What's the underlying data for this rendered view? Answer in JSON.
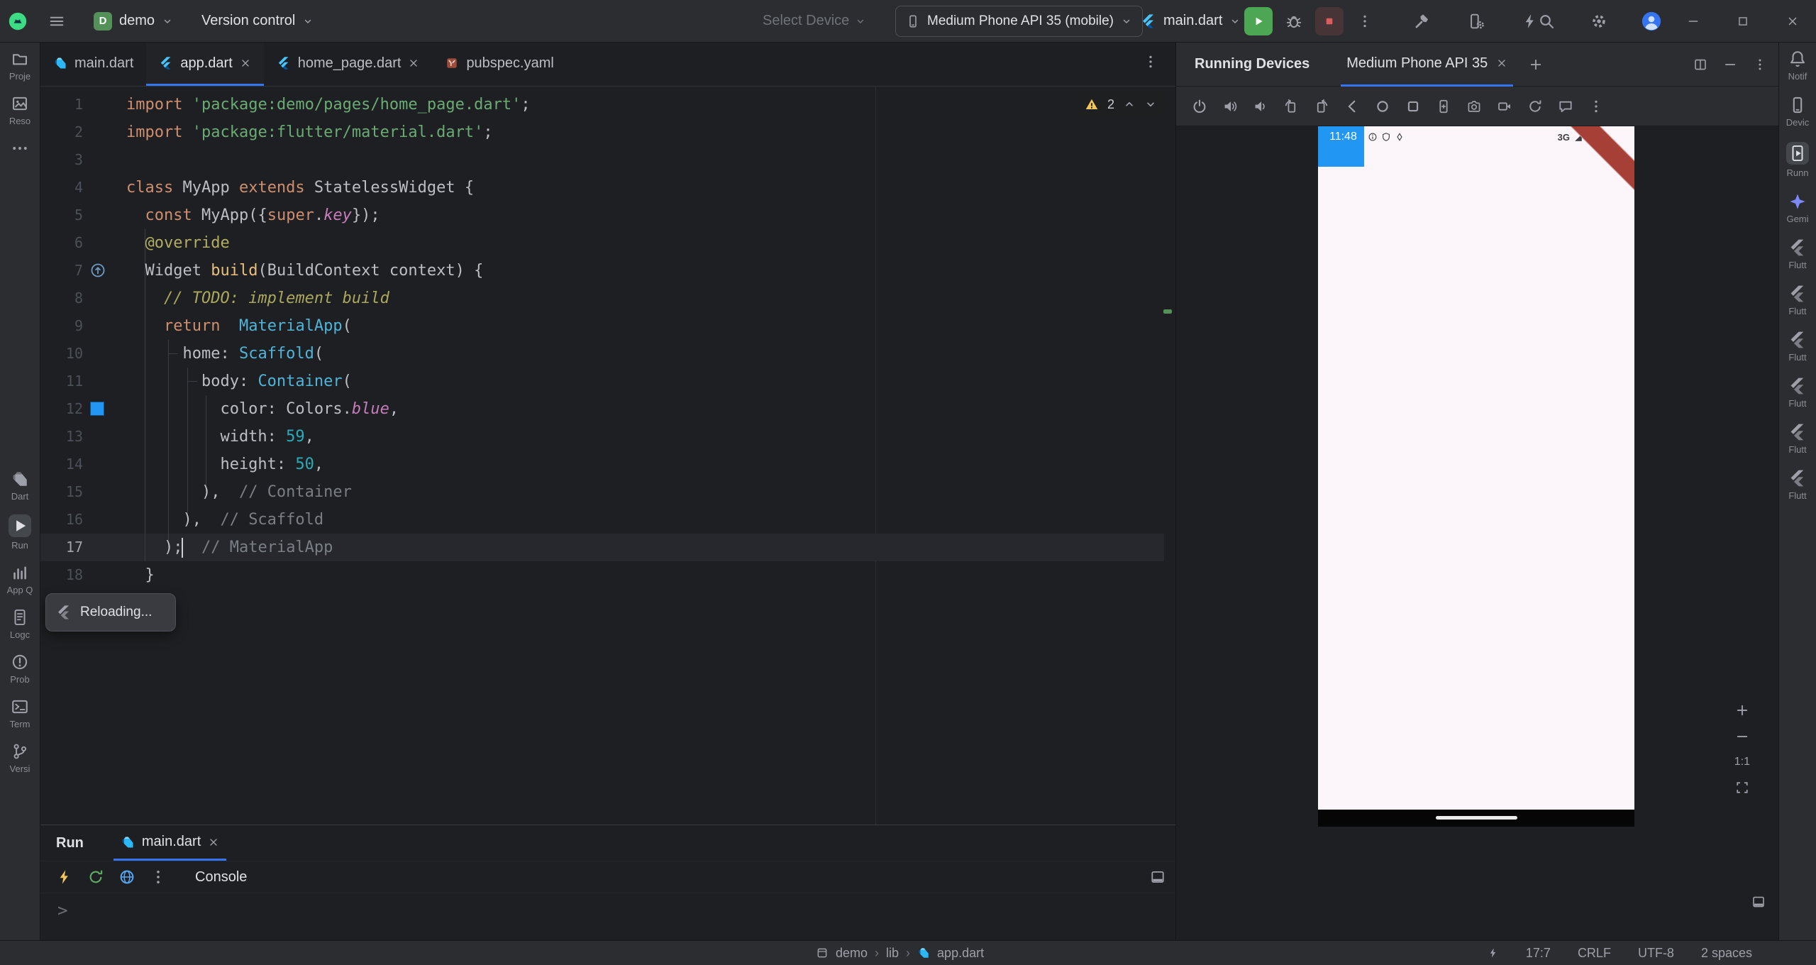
{
  "title_bar": {
    "project_badge": "D",
    "project_name": "demo",
    "vcs_label": "Version control",
    "select_device_label": "Select Device",
    "device_selector": "Medium Phone API 35 (mobile)",
    "run_config": "main.dart",
    "tool_icons": [
      "hammer",
      "device-gear",
      "bolt"
    ],
    "system_icons": [
      "search",
      "gear",
      "avatar"
    ]
  },
  "editor_tabs": [
    {
      "label": "main.dart",
      "icon": "dart",
      "closable": false,
      "active": false
    },
    {
      "label": "app.dart",
      "icon": "flutter",
      "closable": true,
      "active": true
    },
    {
      "label": "home_page.dart",
      "icon": "flutter",
      "closable": true,
      "active": false
    },
    {
      "label": "pubspec.yaml",
      "icon": "yaml",
      "closable": false,
      "active": false
    }
  ],
  "editor": {
    "warning_count": "2",
    "reloading_label": "Reloading...",
    "lines": [
      {
        "t": [
          [
            "k",
            "import"
          ],
          [
            "p",
            " "
          ],
          [
            "s",
            "'package:demo/pages/home_page.dart'"
          ],
          [
            "p",
            ";"
          ]
        ]
      },
      {
        "t": [
          [
            "k",
            "import"
          ],
          [
            "p",
            " "
          ],
          [
            "s",
            "'package:flutter/material.dart'"
          ],
          [
            "p",
            ";"
          ]
        ]
      },
      {
        "t": []
      },
      {
        "t": [
          [
            "k",
            "class"
          ],
          [
            "p",
            " MyApp "
          ],
          [
            "k",
            "extends"
          ],
          [
            "p",
            " StatelessWidget {"
          ]
        ]
      },
      {
        "t": [
          [
            "p",
            "  "
          ],
          [
            "k",
            "const"
          ],
          [
            "p",
            " MyApp({"
          ],
          [
            "k",
            "super"
          ],
          [
            "p",
            "."
          ],
          [
            "f",
            "key"
          ],
          [
            "p",
            "});"
          ]
        ]
      },
      {
        "t": [
          [
            "p",
            "  "
          ],
          [
            "a",
            "@override"
          ]
        ]
      },
      {
        "g": "override",
        "t": [
          [
            "p",
            "  Widget "
          ],
          [
            "m",
            "build"
          ],
          [
            "p",
            "(BuildContext context) {"
          ]
        ]
      },
      {
        "t": [
          [
            "p",
            "    "
          ],
          [
            "td",
            "// TODO: implement build"
          ]
        ]
      },
      {
        "t": [
          [
            "p",
            "    "
          ],
          [
            "k",
            "return"
          ],
          [
            "p",
            "  "
          ],
          [
            "y",
            "MaterialApp"
          ],
          [
            "p",
            "("
          ]
        ]
      },
      {
        "t": [
          [
            "p",
            "      home: "
          ],
          [
            "y",
            "Scaffold"
          ],
          [
            "p",
            "("
          ]
        ]
      },
      {
        "t": [
          [
            "p",
            "        body: "
          ],
          [
            "y",
            "Container"
          ],
          [
            "p",
            "("
          ]
        ]
      },
      {
        "g": "swatch",
        "t": [
          [
            "p",
            "          color: Colors."
          ],
          [
            "f",
            "blue"
          ],
          [
            "p",
            ","
          ]
        ]
      },
      {
        "t": [
          [
            "p",
            "          width: "
          ],
          [
            "n",
            "59"
          ],
          [
            "p",
            ","
          ]
        ]
      },
      {
        "t": [
          [
            "p",
            "          height: "
          ],
          [
            "n",
            "50"
          ],
          [
            "p",
            ","
          ]
        ]
      },
      {
        "t": [
          [
            "p",
            "        ),  "
          ],
          [
            "c",
            "// Container"
          ]
        ]
      },
      {
        "t": [
          [
            "p",
            "      ),  "
          ],
          [
            "c",
            "// Scaffold"
          ]
        ]
      },
      {
        "cur": true,
        "t": [
          [
            "p",
            "    );"
          ],
          [
            "caret",
            ""
          ],
          [
            "p",
            "  "
          ],
          [
            "c",
            "// MaterialApp"
          ]
        ]
      },
      {
        "t": [
          [
            "p",
            "  }"
          ]
        ]
      }
    ]
  },
  "left_stripe": [
    {
      "label": "Proje",
      "icon": "folder"
    },
    {
      "label": "Reso",
      "icon": "image"
    },
    {
      "label": "",
      "icon": "more-h"
    },
    {
      "label": "Dart",
      "icon": "dart-mono",
      "gap": true
    },
    {
      "label": "Run",
      "icon": "play",
      "selected": true
    },
    {
      "label": "App Q",
      "icon": "insights"
    },
    {
      "label": "Logc",
      "icon": "logcat"
    },
    {
      "label": "Prob",
      "icon": "problems"
    },
    {
      "label": "Term",
      "icon": "terminal"
    },
    {
      "label": "Versi",
      "icon": "branch"
    }
  ],
  "right_stripe": [
    {
      "label": "Notif",
      "icon": "bell"
    },
    {
      "label": "Devic",
      "icon": "phone"
    },
    {
      "label": "Runn",
      "icon": "phone-play",
      "selected": true
    },
    {
      "label": "Gemi",
      "icon": "star4"
    },
    {
      "label": "Flutt",
      "icon": "flutter-mono"
    },
    {
      "label": "Flutt",
      "icon": "flutter-mono"
    },
    {
      "label": "Flutt",
      "icon": "flutter-mono"
    },
    {
      "label": "Flutt",
      "icon": "flutter-mono"
    },
    {
      "label": "Flutt",
      "icon": "flutter-mono"
    },
    {
      "label": "Flutt",
      "icon": "flutter-mono"
    }
  ],
  "run_panel": {
    "title": "Run",
    "tab": "main.dart",
    "console_label": "Console",
    "prompt": ">"
  },
  "right_panel": {
    "title": "Running Devices",
    "device_tab": "Medium Phone API 35",
    "zoom_label": "1:1",
    "toolbar": [
      "power",
      "vol-up",
      "vol-down",
      "rotate-left",
      "rotate-right",
      "back",
      "home-o",
      "overview",
      "screenshot",
      "camera",
      "record",
      "sync",
      "message",
      "more-v"
    ],
    "device": {
      "time": "11:48",
      "network": "3G"
    }
  },
  "status_bar": {
    "breadcrumb": [
      {
        "icon": "module",
        "label": "demo"
      },
      {
        "label": "lib"
      },
      {
        "icon": "dart",
        "label": "app.dart"
      }
    ],
    "caret": "17:7",
    "line_ending": "CRLF",
    "encoding": "UTF-8",
    "indent": "2 spaces"
  }
}
